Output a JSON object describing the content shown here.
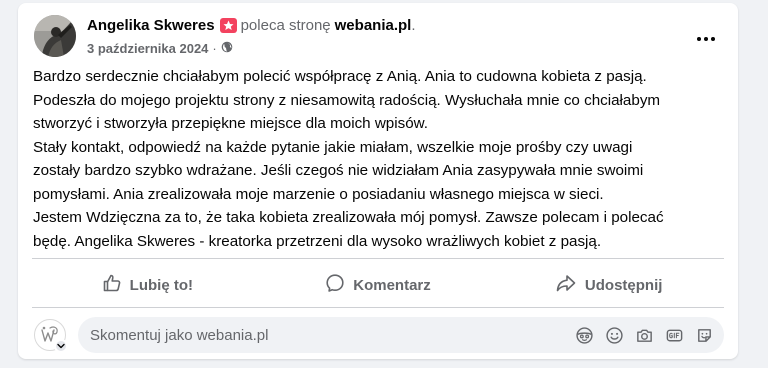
{
  "post": {
    "author": "Angelika Skweres",
    "verb": "poleca stronę",
    "page": "webania.pl",
    "page_suffix": ".",
    "date": "3 października 2024",
    "separator": "·",
    "visibility_icon": "globe-icon",
    "more_icon": "more-options-icon",
    "badge_icon": "recommendation-badge-icon",
    "badge_color": "#f3425f",
    "body_lines": [
      "Bardzo serdecznie chciałabym polecić współpracę z Anią. Ania to cudowna kobieta z pasją.",
      "Podeszła do mojego projektu strony z niesamowitą radością. Wysłuchała mnie co chciałabym",
      "stworzyć i stworzyła przepiękne miejsce dla moich wpisów.",
      "Stały kontakt, odpowiedź na każde pytanie jakie miałam, wszelkie moje prośby czy uwagi",
      "zostały bardzo szybko wdrażane. Jeśli czegoś nie widziałam Ania zasypywała mnie swoimi",
      "pomysłami. Ania zrealizowała moje marzenie o posiadaniu własnego miejsca w sieci.",
      "Jestem Wdzięczna za to, że taka kobieta zrealizowała mój pomysł. Zawsze polecam i polecać",
      "będę. Angelika Skweres - kreatorka przetrzeni dla wysoko wrażliwych kobiet z pasją."
    ]
  },
  "actions": {
    "like_label": "Lubię to!",
    "comment_label": "Komentarz",
    "share_label": "Udostępnij"
  },
  "comment": {
    "placeholder": "Skomentuj jako webania.pl",
    "value": "",
    "icons": [
      "avatar-sticker-icon",
      "emoji-icon",
      "camera-icon",
      "gif-icon",
      "sticker-icon"
    ]
  },
  "colors": {
    "text_primary": "#050505",
    "text_secondary": "#65676b",
    "background": "#f0f2f5",
    "card": "#ffffff",
    "divider": "#ced0d4"
  }
}
